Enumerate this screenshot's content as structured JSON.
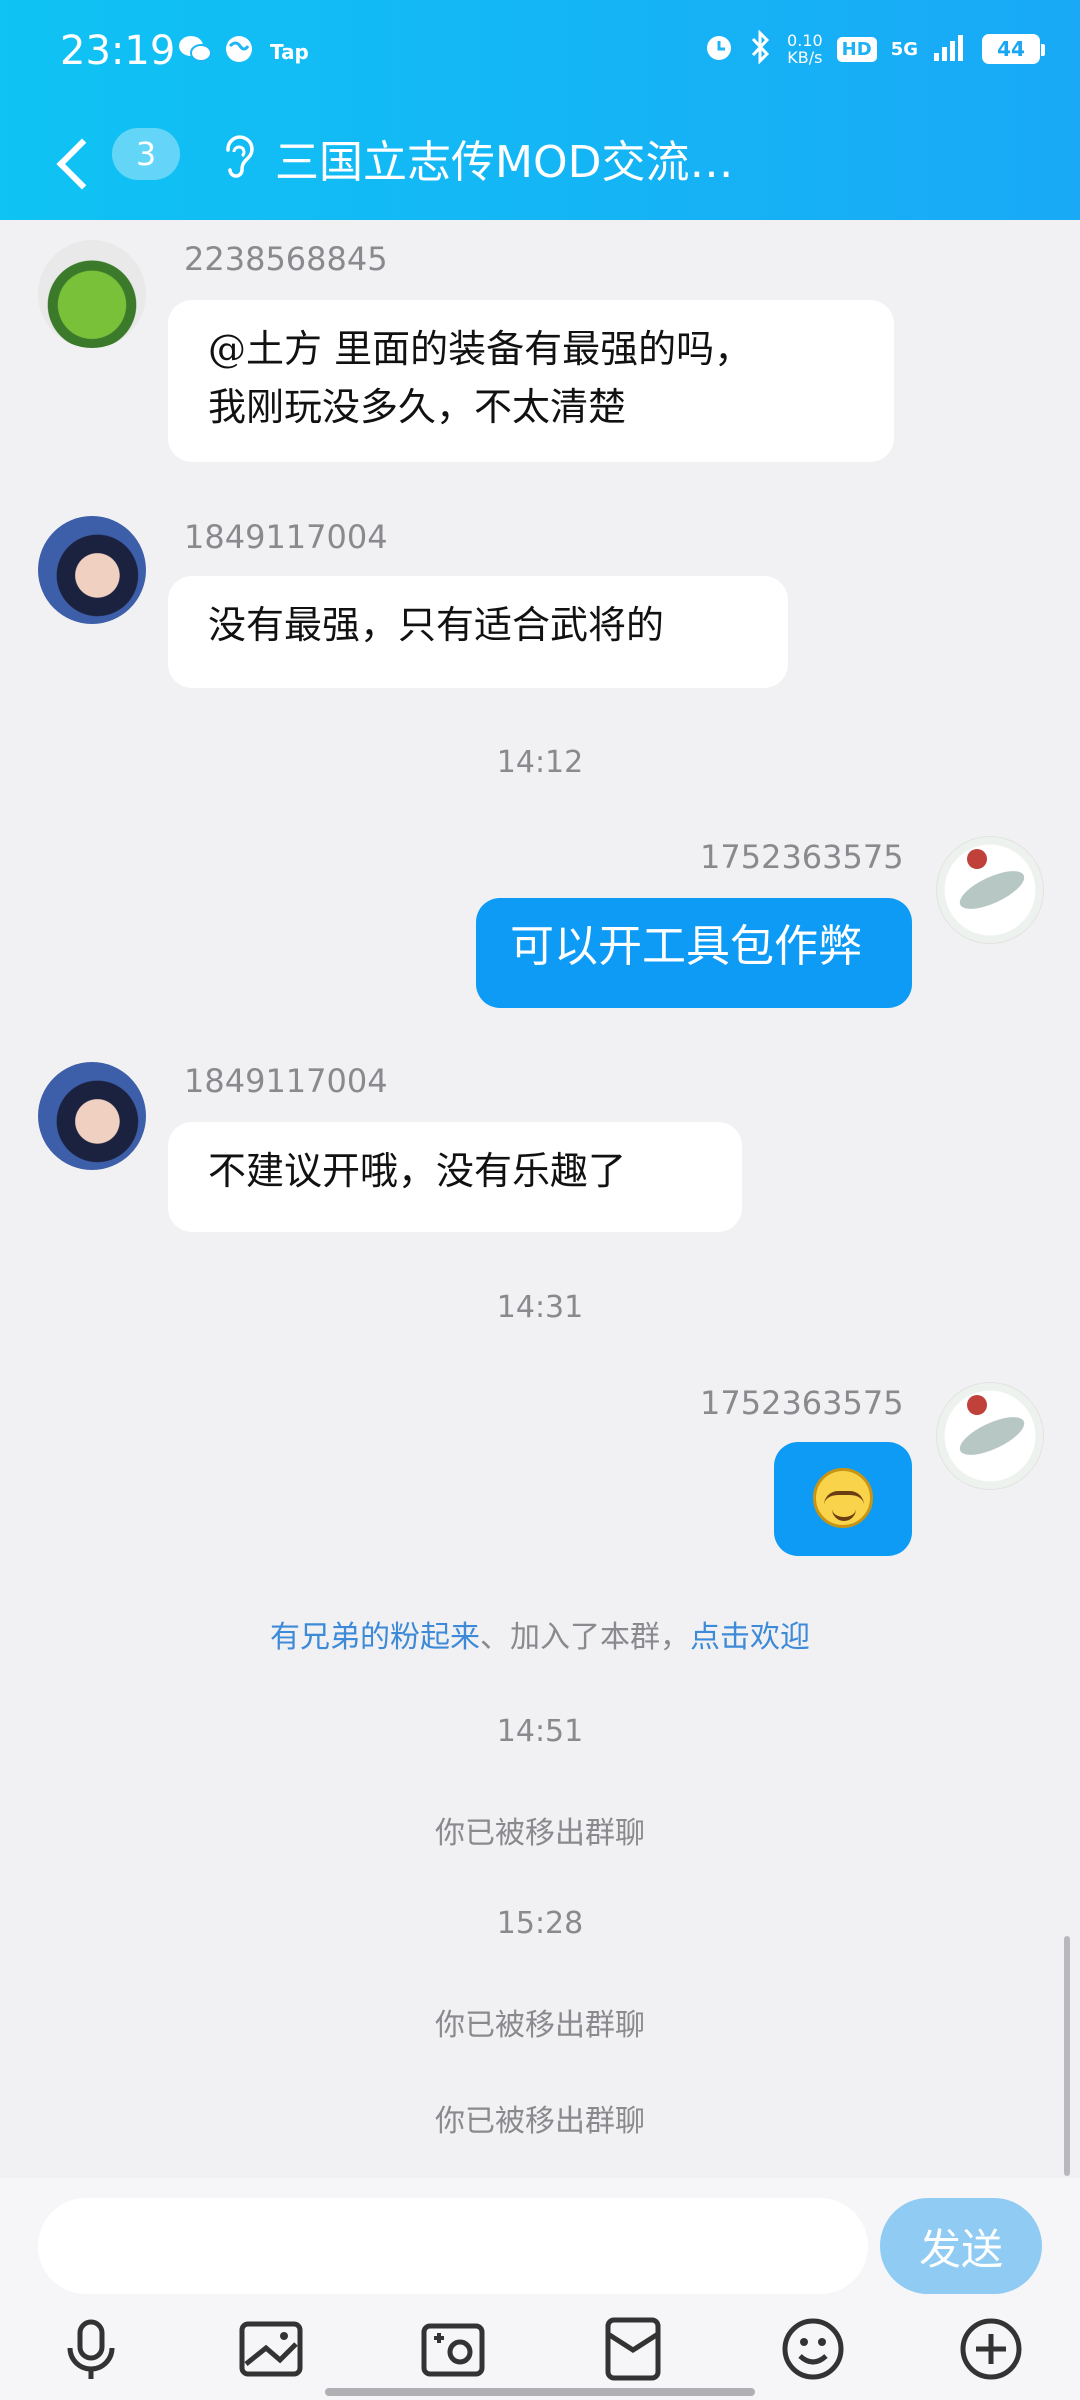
{
  "status_bar": {
    "time": "23:19",
    "tap_label": "Tap",
    "net_speed_value": "0.10",
    "net_speed_unit": "KB/s",
    "hd_label": "HD",
    "network": "5G",
    "battery": "44"
  },
  "header": {
    "unread_count": "3",
    "title": "三国立志传MOD交流…"
  },
  "messages": [
    {
      "uid": "2238568845",
      "text_line1": "@土方 里面的装备有最强的吗，",
      "text_line2": "我刚玩没多久，不太清楚"
    },
    {
      "uid": "1849117004",
      "text": "没有最强，只有适合武将的"
    },
    {
      "time": "14:12"
    },
    {
      "uid": "1752363575",
      "text": "可以开工具包作弊"
    },
    {
      "uid": "1849117004",
      "text": "不建议开哦，没有乐趣了"
    },
    {
      "time": "14:31"
    },
    {
      "uid": "1752363575",
      "emoji": "smirk-emoji"
    }
  ],
  "system": {
    "join_user": "有兄弟的粉起来",
    "join_text": "、加入了本群，",
    "join_link": "点击欢迎",
    "time1": "14:51",
    "removed1": "你已被移出群聊",
    "time2": "15:28",
    "removed2": "你已被移出群聊",
    "removed3": "你已被移出群聊"
  },
  "input": {
    "placeholder": "",
    "send_label": "发送"
  },
  "colors": {
    "header_start": "#0fc3f4",
    "header_end": "#19a9f6",
    "my_bubble": "#0d9bf5",
    "link": "#3d8bd8"
  }
}
